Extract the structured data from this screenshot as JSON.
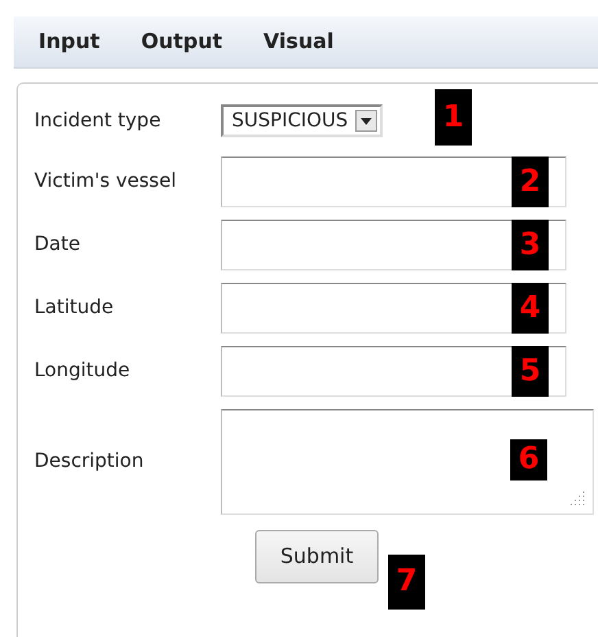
{
  "tabs": [
    {
      "label": "Input"
    },
    {
      "label": "Output"
    },
    {
      "label": "Visual"
    }
  ],
  "form": {
    "fields": [
      {
        "kind": "select",
        "label": "Incident type",
        "value": "SUSPICIOUS",
        "badge": "1"
      },
      {
        "kind": "text",
        "label": "Victim's vessel",
        "badge": "2"
      },
      {
        "kind": "text",
        "label": "Date",
        "badge": "3"
      },
      {
        "kind": "text",
        "label": "Latitude",
        "badge": "4"
      },
      {
        "kind": "text",
        "label": "Longitude",
        "badge": "5"
      },
      {
        "kind": "textarea",
        "label": "Description",
        "badge": "6"
      }
    ],
    "submit": {
      "label": "Submit",
      "badge": "7"
    }
  }
}
